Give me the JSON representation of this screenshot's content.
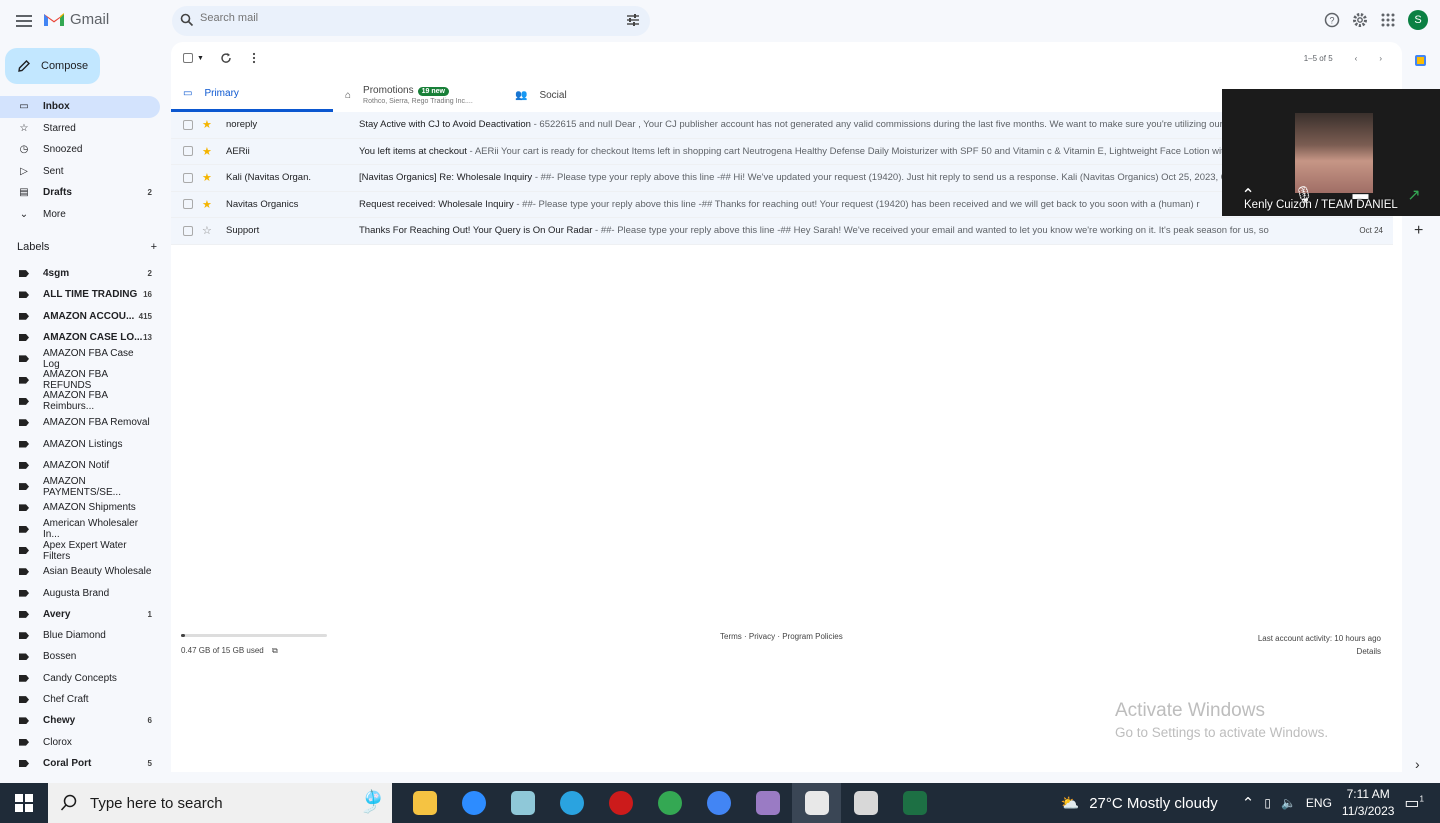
{
  "app": {
    "name": "Gmail",
    "avatar_letter": "S"
  },
  "search": {
    "placeholder": "Search mail"
  },
  "compose_label": "Compose",
  "nav": [
    {
      "label": "Inbox",
      "icon": "inbox-icon",
      "count": "",
      "active": true
    },
    {
      "label": "Starred",
      "icon": "star-icon",
      "count": ""
    },
    {
      "label": "Snoozed",
      "icon": "clock-icon",
      "count": ""
    },
    {
      "label": "Sent",
      "icon": "send-icon",
      "count": ""
    },
    {
      "label": "Drafts",
      "icon": "draft-icon",
      "count": "2",
      "bold": true
    },
    {
      "label": "More",
      "icon": "chevron-down-icon",
      "count": ""
    }
  ],
  "labels_title": "Labels",
  "labels": [
    {
      "label": "4sgm",
      "count": "2",
      "bold": true
    },
    {
      "label": "ALL TIME TRADING",
      "count": "16",
      "bold": true
    },
    {
      "label": "AMAZON ACCOU...",
      "count": "415",
      "bold": true
    },
    {
      "label": "AMAZON CASE LO...",
      "count": "13",
      "bold": true
    },
    {
      "label": "AMAZON FBA Case Log",
      "count": ""
    },
    {
      "label": "AMAZON FBA REFUNDS",
      "count": ""
    },
    {
      "label": "AMAZON FBA Reimburs...",
      "count": ""
    },
    {
      "label": "AMAZON FBA Removal",
      "count": ""
    },
    {
      "label": "AMAZON Listings",
      "count": ""
    },
    {
      "label": "AMAZON Notif",
      "count": ""
    },
    {
      "label": "AMAZON PAYMENTS/SE...",
      "count": ""
    },
    {
      "label": "AMAZON Shipments",
      "count": ""
    },
    {
      "label": "American Wholesaler In...",
      "count": ""
    },
    {
      "label": "Apex Expert Water Filters",
      "count": ""
    },
    {
      "label": "Asian Beauty Wholesale",
      "count": ""
    },
    {
      "label": "Augusta Brand",
      "count": ""
    },
    {
      "label": "Avery",
      "count": "1",
      "bold": true
    },
    {
      "label": "Blue Diamond",
      "count": ""
    },
    {
      "label": "Bossen",
      "count": ""
    },
    {
      "label": "Candy Concepts",
      "count": ""
    },
    {
      "label": "Chef Craft",
      "count": ""
    },
    {
      "label": "Chewy",
      "count": "6",
      "bold": true
    },
    {
      "label": "Clorox",
      "count": ""
    },
    {
      "label": "Coral Port",
      "count": "5",
      "bold": true
    }
  ],
  "pager": {
    "range": "1–5 of 5"
  },
  "tabs": [
    {
      "label": "Primary",
      "sub": "",
      "badge": ""
    },
    {
      "label": "Promotions",
      "sub": "Rothco, Sierra, Rego Trading Inc....",
      "badge": "19 new"
    },
    {
      "label": "Social",
      "sub": "",
      "badge": ""
    }
  ],
  "emails": [
    {
      "sender": "noreply",
      "starred": true,
      "subject": "Stay Active with CJ to Avoid Deactivation",
      "snippet": " - 6522615 and null Dear , Your CJ publisher account has not generated any valid commissions during the last five months. We want to make sure you're utilizing our a",
      "date": ""
    },
    {
      "sender": "AERii",
      "starred": true,
      "subject": "You left items at checkout",
      "snippet": " - AERii Your cart is ready for checkout Items left in shopping cart Neutrogena Healthy Defense Daily Moisturizer with SPF 50 and Vitamin c & Vitamin E, Lightweight Face Lotion with",
      "date": ""
    },
    {
      "sender": "Kali (Navitas Organ.",
      "starred": true,
      "subject": "[Navitas Organics] Re: Wholesale Inquiry",
      "snippet": " - ##- Please type your reply above this line -## Hi! We've updated your request (19420). Just hit reply to send us a response. Kali (Navitas Organics) Oct 25, 2023, 0",
      "date": ""
    },
    {
      "sender": "Navitas Organics",
      "starred": true,
      "subject": "Request received: Wholesale Inquiry",
      "snippet": " - ##- Please type your reply above this line -## Thanks for reaching out! Your request (19420) has been received and we will get back to you soon with a (human) r",
      "date": ""
    },
    {
      "sender": "Support",
      "starred": false,
      "subject": "Thanks For Reaching Out! Your Query is On Our Radar",
      "snippet": " - ##- Please type your reply above this line -## Hey Sarah! We've received your email and wanted to let you know we're working on it. It's peak season for us, so",
      "date": "Oct 24"
    }
  ],
  "footer": {
    "storage": "0.47 GB of 15 GB used",
    "storage_fraction": 0.03,
    "links": "Terms · Privacy · Program Policies",
    "activity": "Last account activity: 10 hours ago",
    "details": "Details"
  },
  "watermark": {
    "title": "Activate Windows",
    "sub": "Go to Settings to activate Windows."
  },
  "video_call": {
    "participant": "Kenly Cuizon / TEAM DANIEL"
  },
  "taskbar": {
    "search_placeholder": "Type here to search",
    "weather": "27°C  Mostly cloudy",
    "language": "ENG",
    "time": "7:11 AM",
    "date": "11/3/2023",
    "notification_count": "1",
    "apps": [
      {
        "name": "file-explorer-icon",
        "color": "#f5c342"
      },
      {
        "name": "zoom-icon",
        "color": "#2d8cff"
      },
      {
        "name": "notepad-icon",
        "color": "#8fc8d8"
      },
      {
        "name": "telegram-icon",
        "color": "#2aa3e0"
      },
      {
        "name": "opera-icon",
        "color": "#cc1b1b"
      },
      {
        "name": "chrome-icon",
        "color": "#34a853"
      },
      {
        "name": "chrome-profile-icon",
        "color": "#4285f4"
      },
      {
        "name": "anime-app-icon",
        "color": "#9a7bc4"
      },
      {
        "name": "cloud-app-icon",
        "color": "#e8e8e8"
      },
      {
        "name": "calculator-icon",
        "color": "#d8d8d8"
      },
      {
        "name": "excel-icon",
        "color": "#1d7044"
      }
    ]
  },
  "colors": {
    "accent": "#0b57d0",
    "compose_bg": "#c2e7ff",
    "star": "#f4b400"
  }
}
